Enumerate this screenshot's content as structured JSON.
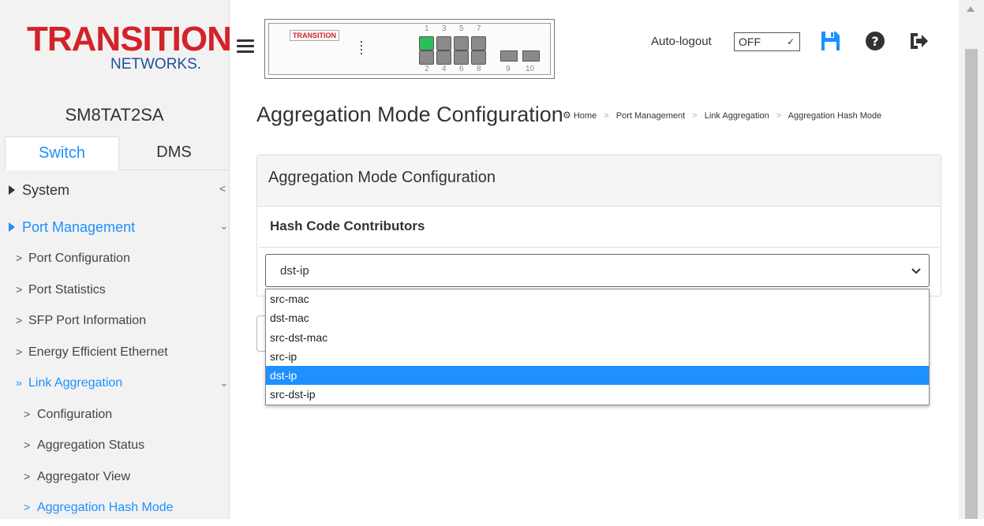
{
  "brand": {
    "logo_line1": "TRANSITION",
    "logo_line2": "NETWORKS.",
    "device_logo": "TRANSITION"
  },
  "device": {
    "ports_top": [
      "1",
      "3",
      "5",
      "7"
    ],
    "ports_bottom": [
      "2",
      "4",
      "6",
      "8"
    ],
    "sfp_ports": [
      "9",
      "10"
    ],
    "port_up_color": "#2dbf57"
  },
  "header": {
    "auto_logout_label": "Auto-logout",
    "auto_logout_value": "OFF",
    "icons": [
      "save-icon",
      "help-icon",
      "logout-icon"
    ]
  },
  "sidebar": {
    "hostname": "SM8TAT2SA",
    "tabs": [
      "Switch",
      "DMS"
    ],
    "system_label": "System",
    "port_mgmt_label": "Port Management",
    "port_items": [
      "Port Configuration",
      "Port Statistics",
      "SFP Port Information",
      "Energy Efficient Ethernet"
    ],
    "link_agg_label": "Link Aggregation",
    "link_agg_items": [
      "Configuration",
      "Aggregation Status",
      "Aggregator View",
      "Aggregation Hash Mode"
    ]
  },
  "main": {
    "page_title": "Aggregation Mode Configuration",
    "breadcrumb": [
      "Home",
      "Port Management",
      "Link Aggregation",
      "Aggregation Hash Mode"
    ],
    "panel_title": "Aggregation Mode Configuration",
    "hash_title": "Hash Code Contributors",
    "selected_value": "dst-ip",
    "options": [
      "src-mac",
      "dst-mac",
      "src-dst-mac",
      "src-ip",
      "dst-ip",
      "src-dst-ip"
    ]
  },
  "colors": {
    "accent": "#1e90ff",
    "brand_red": "#d2232a",
    "brand_blue": "#1f4e9c"
  }
}
